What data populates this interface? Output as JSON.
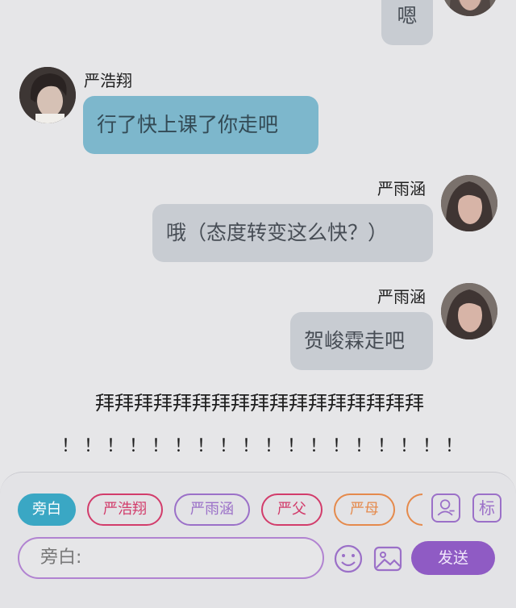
{
  "messages": [
    {
      "side": "right",
      "sender": "",
      "text": "嗯",
      "avatar": "avatar-girl"
    },
    {
      "side": "left",
      "sender": "严浩翔",
      "text": "行了快上课了你走吧",
      "avatar": "avatar-boy"
    },
    {
      "side": "right",
      "sender": "严雨涵",
      "text": "哦（态度转变这么快？）",
      "avatar": "avatar-girl"
    },
    {
      "side": "right",
      "sender": "严雨涵",
      "text": "贺峻霖走吧",
      "avatar": "avatar-girl"
    }
  ],
  "narration": [
    "拜拜拜拜拜拜拜拜拜拜拜拜拜拜拜拜拜",
    "！！！！！！！！！！！！！！！！！！"
  ],
  "role_chips": [
    {
      "label": "旁白",
      "color": "#3aa7c4",
      "active": true
    },
    {
      "label": "严浩翔",
      "color": "#d23c6b",
      "active": false
    },
    {
      "label": "严雨涵",
      "color": "#9b70c8",
      "active": false
    },
    {
      "label": "严父",
      "color": "#d23c6b",
      "active": false
    },
    {
      "label": "严母",
      "color": "#e58a4c",
      "active": false
    }
  ],
  "toolbar": {
    "contact_icon": "contact-card-icon",
    "tag_label": "标"
  },
  "composer": {
    "placeholder": "旁白:",
    "emoji_icon": "smiley-icon",
    "image_icon": "image-icon",
    "send_label": "发送"
  }
}
